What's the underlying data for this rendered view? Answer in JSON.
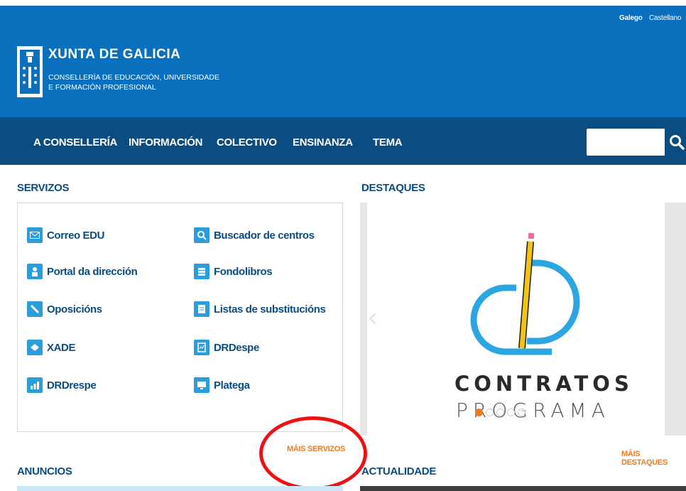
{
  "header": {
    "languages": [
      "Galego",
      "Castellano"
    ],
    "brand_title": "XUNTA DE GALICIA",
    "brand_line1": "CONSELLERÍA DE EDUCACIÓN, UNIVERSIDADE",
    "brand_line2": "E FORMACIÓN PROFESIONAL",
    "logo_icon": "galicia-coat-of-arms-icon",
    "background_color": "#0a70bd"
  },
  "nav": {
    "items": [
      "A CONSELLERÍA",
      "INFORMACIÓN",
      "COLECTIVO",
      "ENSINANZA",
      "TEMA"
    ],
    "search_value": "",
    "search_icon": "search-icon",
    "background_color": "#0b4d80"
  },
  "servizos": {
    "title": "SERVIZOS",
    "items": [
      {
        "label": "Correo EDU",
        "icon": "mail-icon"
      },
      {
        "label": "Buscador de centros",
        "icon": "magnifier-icon"
      },
      {
        "label": "Portal da dirección",
        "icon": "person-icon"
      },
      {
        "label": "Fondolibros",
        "icon": "books-icon"
      },
      {
        "label": "Oposicións",
        "icon": "pencil-icon"
      },
      {
        "label": "Listas de substitucións",
        "icon": "list-icon"
      },
      {
        "label": "XADE",
        "icon": "xade-icon"
      },
      {
        "label": "DRDespe",
        "icon": "document-icon"
      },
      {
        "label": "DRDrespe",
        "icon": "chart-icon"
      },
      {
        "label": "Plategа",
        "icon": "monitor-icon"
      }
    ],
    "more_link": "MÁIS SERVIZOS"
  },
  "destaques": {
    "title": "DESTAQUES",
    "slide_title": "CONTRATOS",
    "slide_subtitle": "PROGRAMA",
    "slide_count": 5,
    "active_slide": 1,
    "more_link": "MÁIS DESTAQUES"
  },
  "anuncios": {
    "title": "ANUNCIOS"
  },
  "actualidade": {
    "title": "ACTUALIDADE"
  },
  "accent_color": "#f07a1e",
  "annotation_color": "#ee1111"
}
